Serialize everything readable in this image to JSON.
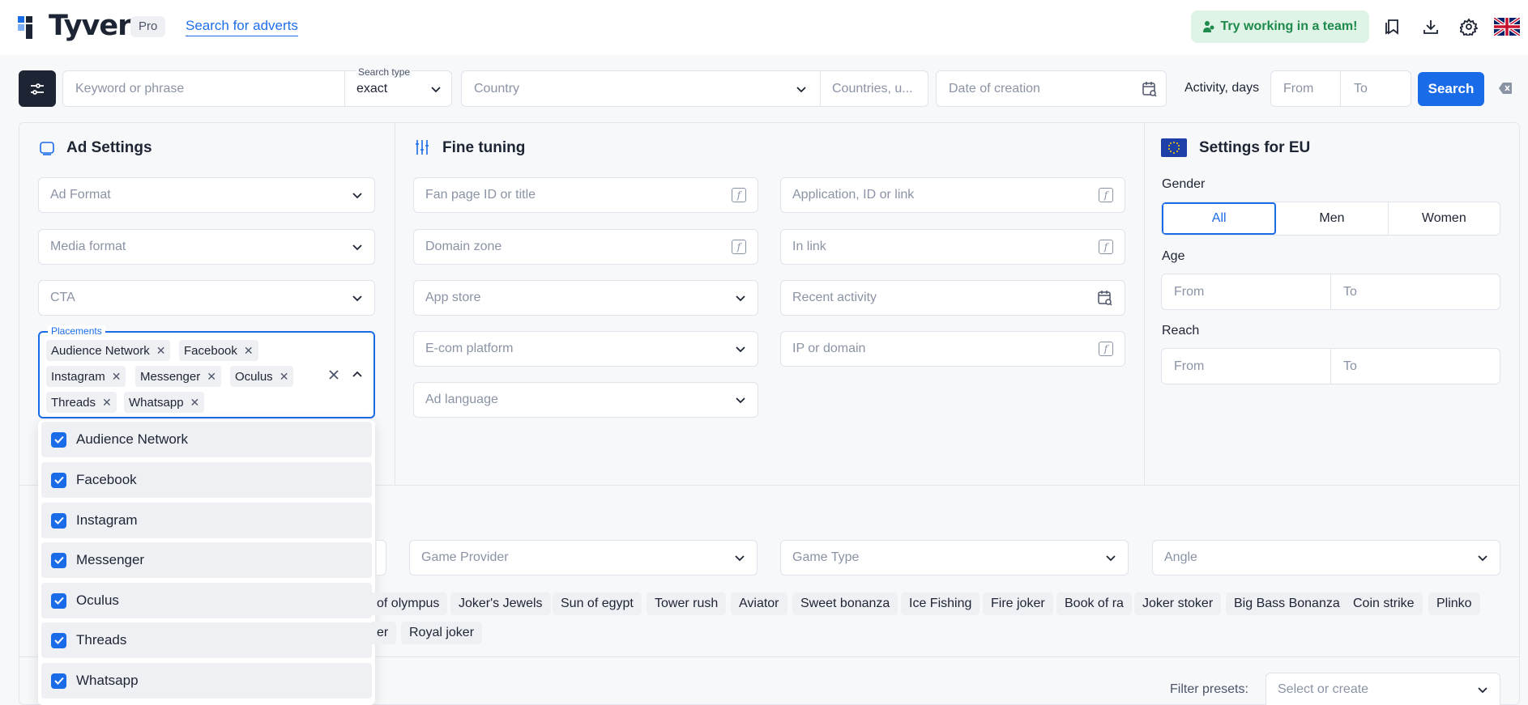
{
  "header": {
    "logo_text": "Tyver",
    "pro_badge": "Pro",
    "search_adverts_link": "Search for adverts",
    "team_button": "Try working in a team!"
  },
  "search_bar": {
    "keyword_placeholder": "Keyword or phrase",
    "search_type_label": "Search type",
    "search_type_value": "exact",
    "country_placeholder": "Country",
    "countries_placeholder": "Countries, u...",
    "date_placeholder": "Date of creation",
    "activity_label": "Activity, days",
    "from_placeholder": "From",
    "to_placeholder": "To",
    "search_button": "Search"
  },
  "ad_settings": {
    "title": "Ad Settings",
    "ad_format": "Ad Format",
    "media_format": "Media format",
    "cta": "CTA",
    "placements_label": "Placements",
    "placement_tags": [
      "Audience Network",
      "Facebook",
      "Instagram",
      "Messenger",
      "Oculus",
      "Threads",
      "Whatsapp"
    ],
    "dropdown_options": [
      "Audience Network",
      "Facebook",
      "Instagram",
      "Messenger",
      "Oculus",
      "Threads",
      "Whatsapp"
    ]
  },
  "fine_tuning": {
    "title": "Fine tuning",
    "fan_page": "Fan page ID or title",
    "application": "Application, ID or link",
    "domain_zone": "Domain zone",
    "in_link": "In link",
    "app_store": "App store",
    "recent_activity": "Recent activity",
    "ecom_platform": "E-com platform",
    "ip_domain": "IP or domain",
    "ad_language": "Ad language"
  },
  "eu_settings": {
    "title": "Settings for EU",
    "gender_label": "Gender",
    "gender_options": [
      "All",
      "Men",
      "Women"
    ],
    "age_label": "Age",
    "reach_label": "Reach",
    "from_placeholder": "From",
    "to_placeholder": "To"
  },
  "gambling": {
    "game_provider": "Game Provider",
    "game_type": "Game Type",
    "angle": "Angle",
    "chips_row1": [
      "of olympus",
      "Joker's Jewels",
      "Sun of egypt",
      "Tower rush",
      "Aviator",
      "Sweet bonanza",
      "Ice Fishing",
      "Fire joker",
      "Book of ra",
      "Joker stoker",
      "Big Bass Bonanza",
      "Coin strike",
      "Plinko"
    ],
    "chips_row2": [
      "er",
      "Royal joker"
    ]
  },
  "footer": {
    "filter_presets_label": "Filter presets:",
    "filter_presets_placeholder": "Select or create"
  },
  "colors": {
    "accent": "#1a6be8",
    "dark": "#1d2433",
    "team_bg": "#dff3e6",
    "team_text": "#1e8a4c"
  }
}
